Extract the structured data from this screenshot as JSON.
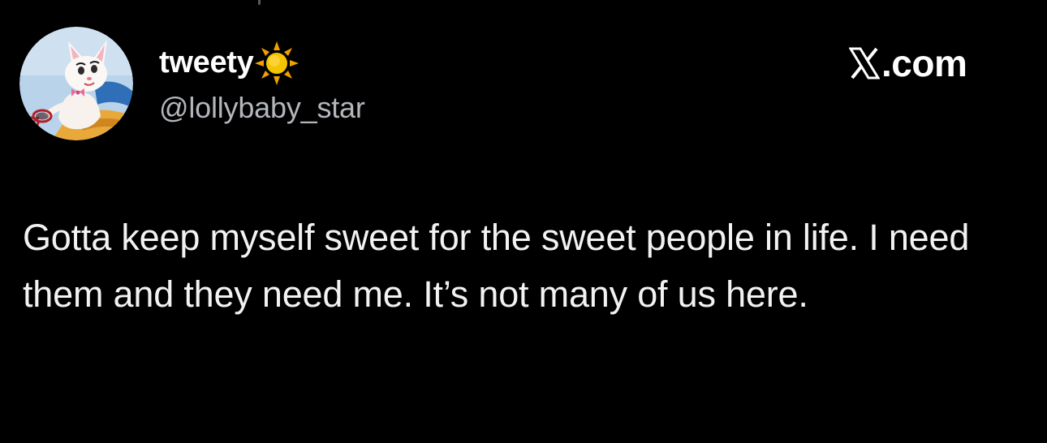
{
  "tweet": {
    "author": {
      "display_name": "tweety",
      "handle": "@lollybaby_star",
      "avatar_icon": "cartoon-cat-avatar",
      "name_emoji_icon": "sun-icon"
    },
    "site": {
      "logo_icon": "x-logo-icon",
      "suffix": ".com"
    },
    "text": "Gotta keep myself sweet for the sweet people in life. I need them and they need me. It’s not many of us here."
  },
  "theme": {
    "background": "#000000",
    "primary_text": "#ffffff",
    "secondary_text": "#b3b6ba",
    "sun_color": "#f5c400",
    "sun_ray_color": "#f0a000"
  }
}
